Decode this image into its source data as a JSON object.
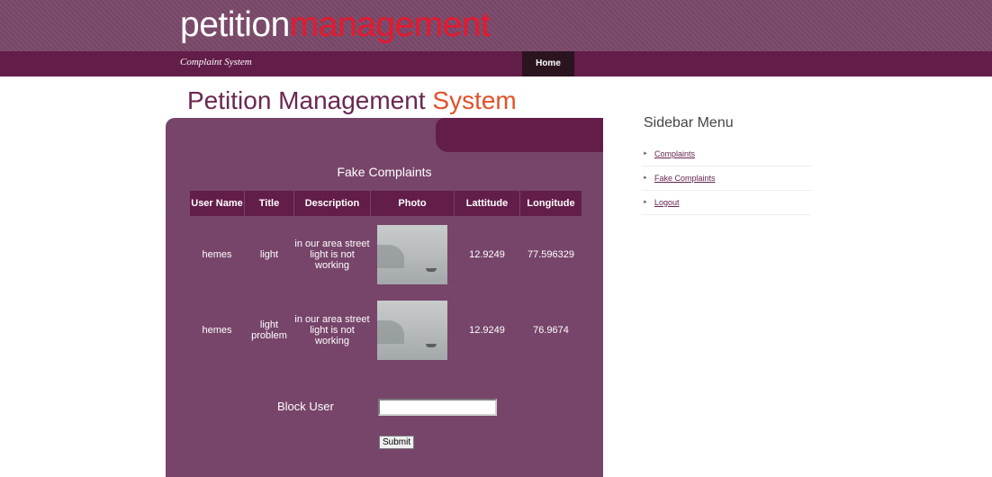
{
  "header": {
    "logo_part1": "petition",
    "logo_part2": "management",
    "tagline": "Complaint System",
    "nav": [
      {
        "label": "Home"
      }
    ]
  },
  "page": {
    "title_main": "Petition Management ",
    "title_highlight": "System"
  },
  "panel": {
    "heading": "Fake Complaints",
    "columns": [
      "User Name",
      "Title",
      "Description",
      "Photo",
      "Lattitude",
      "Longitude"
    ],
    "rows": [
      {
        "user": "hemes",
        "title": "light",
        "description": "in our area street light is not working",
        "photo_icon": "foggy-lake-photo",
        "lat": "12.9249",
        "lng": "77.596329"
      },
      {
        "user": "hemes",
        "title": "light problem",
        "description": "in our area street light is not working",
        "photo_icon": "foggy-lake-photo",
        "lat": "12.9249",
        "lng": "76.9674"
      }
    ],
    "block_label": "Block User",
    "block_value": "",
    "submit_label": "Submit"
  },
  "sidebar": {
    "title": "Sidebar Menu",
    "items": [
      {
        "label": "Complaints"
      },
      {
        "label": "Fake Complaints"
      },
      {
        "label": "Logout"
      }
    ]
  },
  "colors": {
    "header_bg": "#7a4869",
    "nav_bg": "#621d49",
    "panel_bg": "#77456a",
    "accent_red": "#e8182d",
    "accent_orange": "#e0512a"
  }
}
